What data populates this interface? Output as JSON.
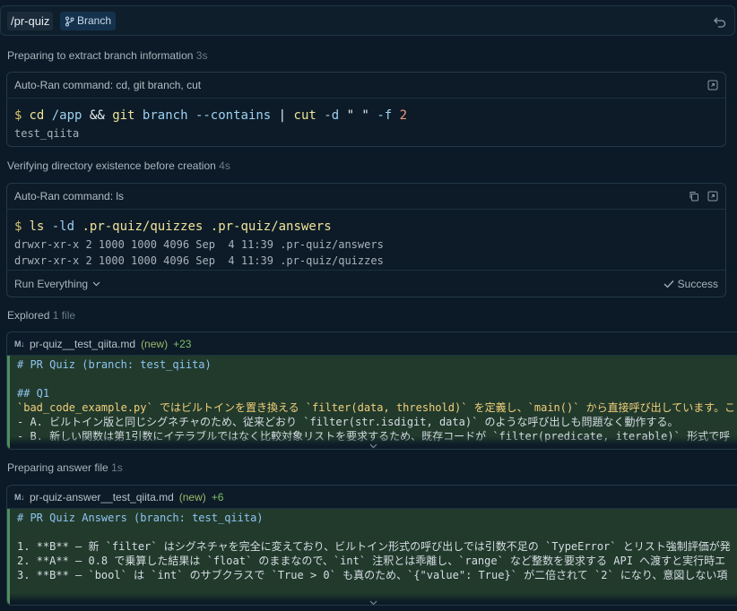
{
  "topbar": {
    "context_chip": "/pr-quiz",
    "branch_chip": "Branch"
  },
  "steps": [
    {
      "label": "Preparing to extract branch information",
      "duration": "3s"
    },
    {
      "label": "Verifying directory existence before creation",
      "duration": "4s"
    },
    {
      "label": "Explored",
      "duration": "1 file"
    },
    {
      "label": "Preparing answer file",
      "duration": "1s"
    }
  ],
  "command1": {
    "title": "Auto-Ran command: cd, git branch, cut",
    "prompt": "$",
    "tokens": [
      "cd",
      "/app",
      "&&",
      "git",
      "branch",
      "--contains",
      "|",
      "cut",
      "-d",
      "\" \"",
      "-f",
      "2"
    ],
    "output": [
      "test_qiita"
    ]
  },
  "command2": {
    "title": "Auto-Ran command: ls",
    "prompt": "$",
    "tokens": [
      "ls",
      "-ld",
      ".pr-quiz/quizzes",
      ".pr-quiz/answers"
    ],
    "output": [
      "drwxr-xr-x 2 1000 1000 4096 Sep  4 11:39 .pr-quiz/answers",
      "drwxr-xr-x 2 1000 1000 4096 Sep  4 11:39 .pr-quiz/quizzes"
    ],
    "footer_left": "Run Everything",
    "footer_right": "Success"
  },
  "file1": {
    "badge": "M↓",
    "name": "pr-quiz__test_qiita.md",
    "tag": "(new)",
    "added": "+23",
    "lines": [
      "# PR Quiz (branch: test_qiita)",
      "",
      "## Q1",
      "`bad_code_example.py` ではビルトインを置き換える `filter(data, threshold)` を定義し、`main()` から直接呼び出しています。こ",
      "- A. ビルトイン版と同じシグネチャのため、従来どおり `filter(str.isdigit, data)` のような呼び出しも問題なく動作する。",
      "- B. 新しい関数は第1引数にイテラブルではなく比較対象リストを要求するため、既存コードが `filter(predicate, iterable)` 形式で呼"
    ]
  },
  "file2": {
    "badge": "M↓",
    "name": "pr-quiz-answer__test_qiita.md",
    "tag": "(new)",
    "added": "+6",
    "lines": [
      "# PR Quiz Answers (branch: test_qiita)",
      "",
      "1. **B** — 新 `filter` はシグネチャを完全に変えており、ビルトイン形式の呼び出しでは引数不足の `TypeError` とリスト強制評価が発",
      "2. **A** — 0.8 で乗算した結果は `float` のままなので、`int` 注釈とは乖離し、`range` など整数を要求する API へ渡すと実行時エ",
      "3. **B** — `bool` は `int` のサブクラスで `True > 0` も真のため、`{\"value\": True}` が二倍されて `2` になり、意図しない項"
    ]
  },
  "colors": {
    "background": "#0b1a26",
    "diff_add_bg": "#213a2c",
    "accent": "#14324d"
  }
}
